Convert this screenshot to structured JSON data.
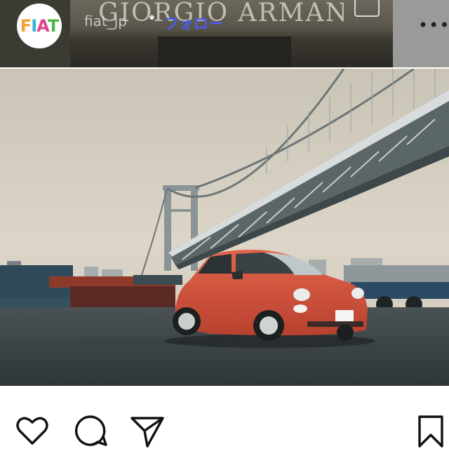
{
  "post": {
    "account": {
      "username": "fiat_jp",
      "avatar_logo": "FIAT",
      "follow_label": "フォロー",
      "separator": "•"
    },
    "background_sign": "GIORGIO ARMANI",
    "more_label": "•••",
    "image_icon": "photo-of-red-fiat-500-under-suspension-bridge"
  },
  "actions": {
    "like_icon": "heart-icon",
    "comment_icon": "comment-icon",
    "share_icon": "share-icon",
    "save_icon": "bookmark-icon"
  },
  "colors": {
    "follow_text": "#4a5cf0",
    "car": "#d9533d",
    "logo_f": "#f3a22f",
    "logo_i": "#30b2e2",
    "logo_a": "#e0458c",
    "logo_t": "#4cb848"
  }
}
